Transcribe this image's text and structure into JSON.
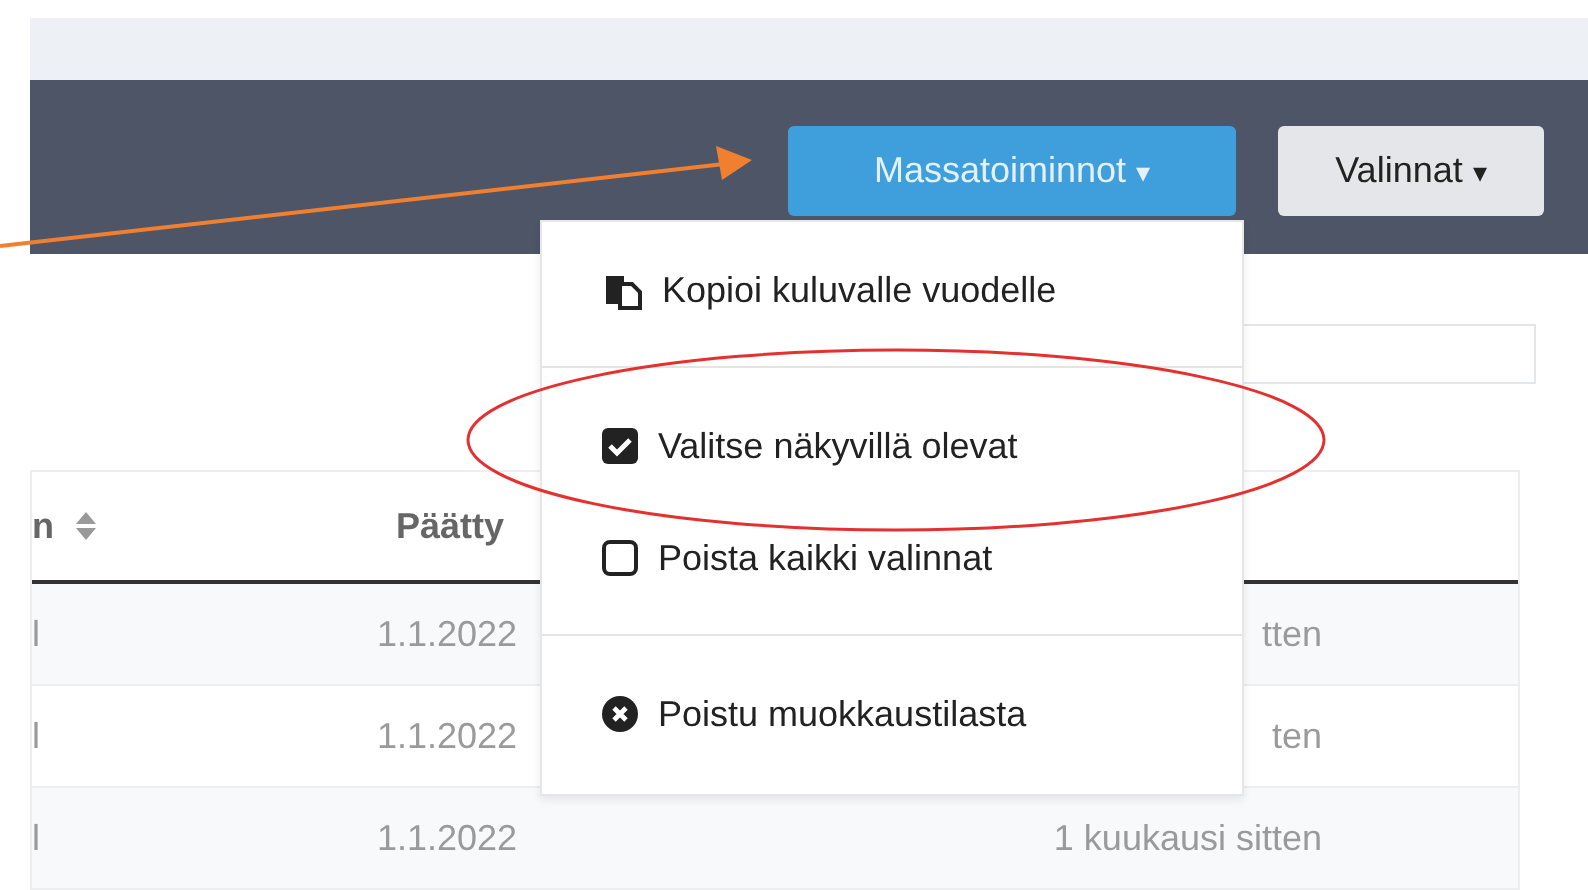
{
  "toolbar": {
    "buttons": [
      {
        "label": "Massatoiminnot",
        "kind": "primary",
        "caret": "▾"
      },
      {
        "label": "Valinnat",
        "kind": "secondary",
        "caret": "▾"
      }
    ]
  },
  "dropdown": {
    "items": [
      {
        "kind": "copy",
        "label": "Kopioi kuluvalle vuodelle"
      },
      {
        "kind": "divider"
      },
      {
        "kind": "checkbox",
        "label": "Valitse näkyvillä olevat",
        "checked": true
      },
      {
        "kind": "checkbox",
        "label": "Poista kaikki valinnat",
        "checked": false
      },
      {
        "kind": "divider"
      },
      {
        "kind": "exit",
        "label": "Poistu muokkaustilasta"
      }
    ]
  },
  "table": {
    "columns": [
      "n",
      "Päätty"
    ],
    "rows": [
      {
        "column_1": "l",
        "column_2": "1.1.2022",
        "column_3": "tten"
      },
      {
        "column_1": "l",
        "column_2": "1.1.2022",
        "column_3": "ten"
      },
      {
        "column_1": "l",
        "column_2": "1.1.2022",
        "column_3": "1 kuukausi sitten"
      }
    ]
  }
}
